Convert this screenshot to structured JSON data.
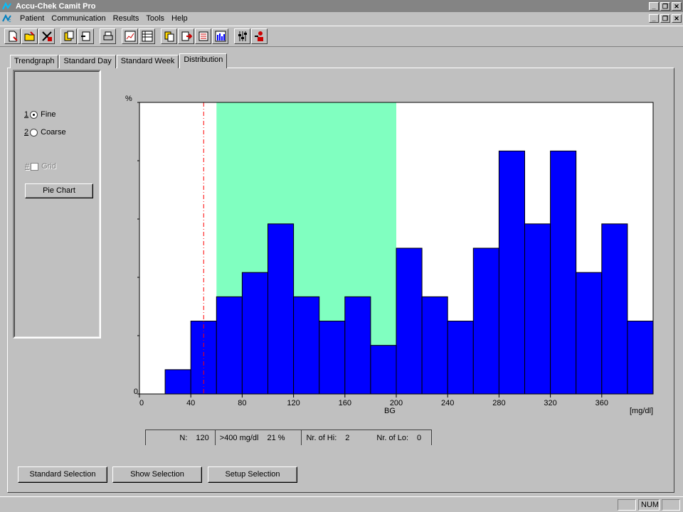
{
  "window": {
    "title": "Accu-Chek Camit Pro",
    "buttons": [
      "_",
      "❐",
      "✕"
    ]
  },
  "menu": {
    "items": [
      {
        "label": "Patient"
      },
      {
        "label": "Communication"
      },
      {
        "label": "Results"
      },
      {
        "label": "Tools"
      },
      {
        "label": "Help"
      }
    ]
  },
  "tabs": [
    {
      "label": "Trendgraph"
    },
    {
      "label": "Standard Day"
    },
    {
      "label": "Standard Week"
    },
    {
      "label": "Distribution"
    }
  ],
  "options": {
    "fine": {
      "num": "1",
      "label": "Fine"
    },
    "coarse": {
      "num": "2",
      "label": "Coarse"
    },
    "grid": {
      "num": "#",
      "label": "Grid"
    },
    "pie_chart": "Pie Chart"
  },
  "chart_data": {
    "type": "bar",
    "ylabel_top": "%",
    "y_zero_label": "0",
    "xlabel": "BG",
    "xunit": "[mg/dl]",
    "xlim": [
      0,
      400
    ],
    "x_ticks": [
      "0",
      "40",
      "80",
      "120",
      "160",
      "200",
      "240",
      "280",
      "320",
      "360"
    ],
    "target_range": [
      60,
      200
    ],
    "hypo_limit": 50,
    "bin_width": 20,
    "bins_start": [
      20,
      40,
      60,
      80,
      100,
      120,
      140,
      160,
      180,
      200,
      220,
      240,
      260,
      280,
      300,
      320,
      340,
      360,
      380
    ],
    "values": [
      1,
      3,
      4,
      5,
      7,
      4,
      3,
      4,
      2,
      6,
      4,
      3,
      6,
      10,
      7,
      10,
      5,
      7,
      3
    ],
    "ylim": [
      0,
      12
    ],
    "colors": {
      "bars": "#0000ff",
      "target": "#80ffc0",
      "hypo_line": "#ff0000"
    }
  },
  "stats": {
    "n_label": "N:",
    "n_value": "120",
    "above_label": ">400 mg/dl",
    "above_value": "21 %",
    "hi_label": "Nr. of Hi:",
    "hi_value": "2",
    "lo_label": "Nr. of Lo:",
    "lo_value": "0"
  },
  "bottom_buttons": {
    "standard": "Standard Selection",
    "show": "Show Selection",
    "setup": "Setup Selection"
  },
  "statusbar": {
    "num": "NUM"
  }
}
